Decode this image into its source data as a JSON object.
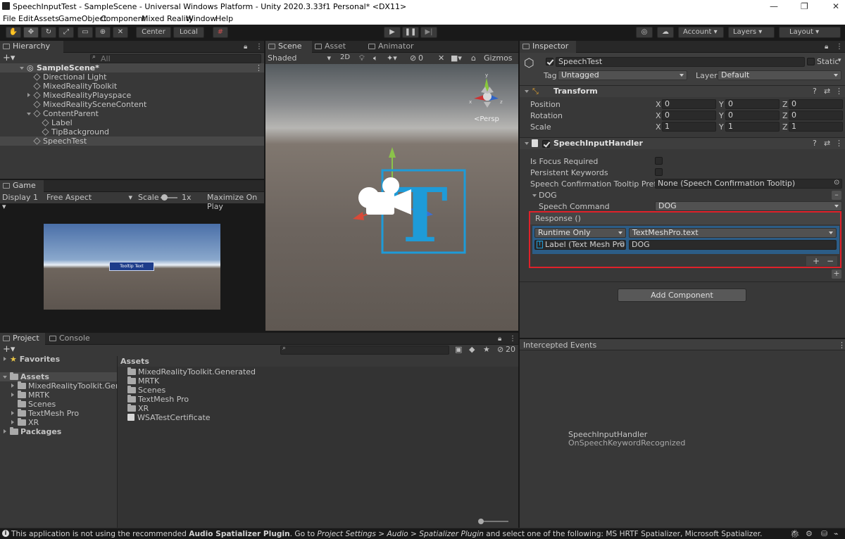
{
  "window": {
    "title": "SpeechInputTest - SampleScene - Universal Windows Platform - Unity 2020.3.33f1 Personal* <DX11>"
  },
  "menu": [
    "File",
    "Edit",
    "Assets",
    "GameObject",
    "Component",
    "Mixed Reality",
    "Window",
    "Help"
  ],
  "toolbar": {
    "center": "Center",
    "local": "Local",
    "account": "Account",
    "layers": "Layers",
    "layout": "Layout"
  },
  "hierarchy": {
    "tab": "Hierarchy",
    "search_placeholder": "All",
    "scene": "SampleScene*",
    "items": [
      "Directional Light",
      "MixedRealityToolkit",
      "MixedRealityPlayspace",
      "MixedRealitySceneContent",
      "ContentParent",
      "Label",
      "TipBackground",
      "SpeechTest"
    ]
  },
  "game": {
    "tab": "Game",
    "display": "Display 1",
    "aspect": "Free Aspect",
    "scale_label": "Scale",
    "scale_value": "1x",
    "maximize": "Maximize On Play",
    "tooltip": "Tooltip Text"
  },
  "scene": {
    "tabs": [
      "Scene",
      "Asset Store",
      "Animator"
    ],
    "shading": "Shaded",
    "mode2d": "2D",
    "hidden_count": "0",
    "gizmos": "Gizmos",
    "persp": "<Persp"
  },
  "project": {
    "tabs": [
      "Project",
      "Console"
    ],
    "favorites": "Favorites",
    "assets": "Assets",
    "packages": "Packages",
    "tree": [
      "MixedRealityToolkit.Genera",
      "MRTK",
      "Scenes",
      "TextMesh Pro",
      "XR"
    ],
    "breadcrumb": "Assets",
    "files": [
      "MixedRealityToolkit.Generated",
      "MRTK",
      "Scenes",
      "TextMesh Pro",
      "XR",
      "WSATestCertificate"
    ],
    "hidden_count": "20"
  },
  "inspector": {
    "tab": "Inspector",
    "object_name": "SpeechTest",
    "static": "Static",
    "tag_label": "Tag",
    "tag": "Untagged",
    "layer_label": "Layer",
    "layer": "Default",
    "transform": {
      "title": "Transform",
      "position": "Position",
      "rotation": "Rotation",
      "scale": "Scale",
      "values": {
        "px": "0",
        "py": "0",
        "pz": "0",
        "rx": "0",
        "ry": "0",
        "rz": "0",
        "sx": "1",
        "sy": "1",
        "sz": "1"
      },
      "axes": [
        "X",
        "Y",
        "Z"
      ]
    },
    "handler": {
      "title": "SpeechInputHandler",
      "focus": "Is Focus Required",
      "persistent": "Persistent Keywords",
      "prefab_label": "Speech Confirmation Tooltip Prefab",
      "prefab_value": "None (Speech Confirmation Tooltip)",
      "keyword": "DOG",
      "command_label": "Speech Command",
      "command_value": "DOG",
      "response": "Response ()",
      "runtime": "Runtime Only",
      "function": "TextMeshPro.text",
      "target": "Label (Text Mesh Pro)",
      "arg": "DOG"
    },
    "add_component": "Add Component"
  },
  "events": {
    "title": "Intercepted Events",
    "line1": "SpeechInputHandler",
    "line2": "OnSpeechKeywordRecognized"
  },
  "status": {
    "pre": "This application is not using the recommended ",
    "b1": "Audio Spatializer Plugin",
    "mid": ". Go to ",
    "i1": "Project Settings > Audio > Spatializer Plugin",
    "post": " and select one of the following: MS HRTF Spatializer, Microsoft Spatializer."
  },
  "colors": {
    "highlight": "#e0212a",
    "selection": "#2c5d87",
    "t_blue": "#1e9bd8"
  }
}
